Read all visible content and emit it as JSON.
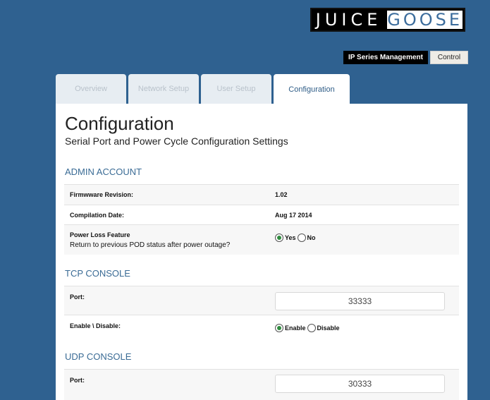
{
  "logo": {
    "left_text": "JUICE",
    "right_text": "GOOSE"
  },
  "topnav": {
    "items": [
      {
        "label": "IP Series Management",
        "active": true
      },
      {
        "label": "Control",
        "active": false
      }
    ]
  },
  "tabs": [
    {
      "label": "Overview",
      "active": false
    },
    {
      "label": "Network Setup",
      "active": false
    },
    {
      "label": "User Setup",
      "active": false
    },
    {
      "label": "Configuration",
      "active": true
    }
  ],
  "page": {
    "title": "Configuration",
    "subtitle": "Serial Port and Power Cycle Configuration Settings"
  },
  "admin": {
    "heading": "ADMIN ACCOUNT",
    "firmware_label": "Firmwware Revision:",
    "firmware_value": "1.02",
    "compilation_label": "Compilation Date:",
    "compilation_value": "Aug 17 2014",
    "power_loss_label": "Power Loss Feature",
    "power_loss_desc": "Return to previous POD status after power outage?",
    "power_loss_options": [
      {
        "label": "Yes",
        "checked": true
      },
      {
        "label": "No",
        "checked": false
      }
    ]
  },
  "tcp": {
    "heading": "TCP CONSOLE",
    "port_label": "Port:",
    "port_value": "33333",
    "enable_label": "Enable \\ Disable:",
    "enable_options": [
      {
        "label": "Enable",
        "checked": true
      },
      {
        "label": "Disable",
        "checked": false
      }
    ]
  },
  "udp": {
    "heading": "UDP CONSOLE",
    "port_label": "Port:",
    "port_value": "30333"
  },
  "colors": {
    "background": "#2f6190",
    "heading": "#3a6b95",
    "radio_checked": "#2e8b3e"
  }
}
